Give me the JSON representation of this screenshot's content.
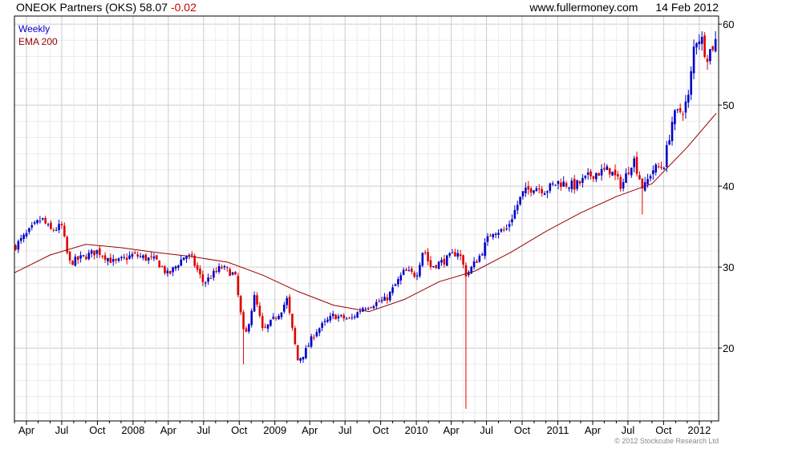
{
  "header": {
    "symbol_text": "ONEOK Partners (OKS) 58.07",
    "change": "-0.02",
    "website": "www.fullermoney.com",
    "date": "14 Feb 2012"
  },
  "footer": {
    "copyright": "© 2012 Stockcube Research Ltd"
  },
  "chart_data": {
    "type": "candlestick",
    "frequency": "Weekly",
    "grid": true,
    "legend_position": "top-left",
    "ylim": [
      11,
      61
    ],
    "y_ticks": [
      20,
      30,
      40,
      50,
      60
    ],
    "x_range": [
      "2007-03-01",
      "2012-02-20"
    ],
    "x_ticks": [
      {
        "date": "2007-04-01",
        "label": "Apr"
      },
      {
        "date": "2007-07-01",
        "label": "Jul"
      },
      {
        "date": "2007-10-01",
        "label": "Oct"
      },
      {
        "date": "2008-01-01",
        "label": "2008"
      },
      {
        "date": "2008-04-01",
        "label": "Apr"
      },
      {
        "date": "2008-07-01",
        "label": "Jul"
      },
      {
        "date": "2008-10-01",
        "label": "Oct"
      },
      {
        "date": "2009-01-01",
        "label": "2009"
      },
      {
        "date": "2009-04-01",
        "label": "Apr"
      },
      {
        "date": "2009-07-01",
        "label": "Jul"
      },
      {
        "date": "2009-10-01",
        "label": "Oct"
      },
      {
        "date": "2010-01-01",
        "label": "2010"
      },
      {
        "date": "2010-04-01",
        "label": "Apr"
      },
      {
        "date": "2010-07-01",
        "label": "Jul"
      },
      {
        "date": "2010-10-01",
        "label": "Oct"
      },
      {
        "date": "2011-01-01",
        "label": "2011"
      },
      {
        "date": "2011-04-01",
        "label": "Apr"
      },
      {
        "date": "2011-07-01",
        "label": "Jul"
      },
      {
        "date": "2011-10-01",
        "label": "Oct"
      },
      {
        "date": "2012-01-01",
        "label": "2012"
      }
    ],
    "series": [
      {
        "name": "Weekly",
        "color_up": "#0000cc",
        "color_down": "#dd0000",
        "anchors": [
          [
            "2007-03-01",
            32.5
          ],
          [
            "2007-04-01",
            34.0
          ],
          [
            "2007-05-10",
            36.0
          ],
          [
            "2007-06-01",
            34.5
          ],
          [
            "2007-07-01",
            35.0
          ],
          [
            "2007-07-20",
            30.5
          ],
          [
            "2007-08-15",
            31.0
          ],
          [
            "2007-10-01",
            32.0
          ],
          [
            "2007-11-15",
            30.5
          ],
          [
            "2008-01-01",
            31.5
          ],
          [
            "2008-03-01",
            30.8
          ],
          [
            "2008-04-01",
            29.0
          ],
          [
            "2008-05-15",
            31.5
          ],
          [
            "2008-06-01",
            31.0
          ],
          [
            "2008-07-01",
            28.0
          ],
          [
            "2008-08-15",
            30.0
          ],
          [
            "2008-09-20",
            29.0
          ],
          [
            "2008-10-15",
            21.0
          ],
          [
            "2008-11-10",
            26.5
          ],
          [
            "2008-12-01",
            22.0
          ],
          [
            "2009-01-15",
            24.5
          ],
          [
            "2009-02-01",
            26.0
          ],
          [
            "2009-03-01",
            18.5
          ],
          [
            "2009-03-20",
            19.5
          ],
          [
            "2009-04-15",
            22.0
          ],
          [
            "2009-06-01",
            24.0
          ],
          [
            "2009-07-15",
            23.5
          ],
          [
            "2009-08-15",
            25.0
          ],
          [
            "2009-10-15",
            26.0
          ],
          [
            "2009-12-01",
            29.5
          ],
          [
            "2010-01-01",
            29.0
          ],
          [
            "2010-01-20",
            32.5
          ],
          [
            "2010-02-05",
            30.0
          ],
          [
            "2010-03-15",
            30.8
          ],
          [
            "2010-04-20",
            32.0
          ],
          [
            "2010-05-10",
            29.0
          ],
          [
            "2010-06-15",
            31.5
          ],
          [
            "2010-07-15",
            34.5
          ],
          [
            "2010-08-20",
            34.5
          ],
          [
            "2010-10-01",
            39.0
          ],
          [
            "2010-11-01",
            40.0
          ],
          [
            "2010-12-01",
            39.5
          ],
          [
            "2011-01-01",
            40.5
          ],
          [
            "2011-02-15",
            40.0
          ],
          [
            "2011-04-01",
            41.5
          ],
          [
            "2011-05-15",
            42.0
          ],
          [
            "2011-06-15",
            40.0
          ],
          [
            "2011-07-15",
            43.5
          ],
          [
            "2011-08-10",
            39.5
          ],
          [
            "2011-09-01",
            42.0
          ],
          [
            "2011-10-01",
            42.5
          ],
          [
            "2011-10-25",
            48.5
          ],
          [
            "2011-11-20",
            49.5
          ],
          [
            "2011-12-05",
            51.0
          ],
          [
            "2011-12-20",
            58.0
          ],
          [
            "2012-01-05",
            58.5
          ],
          [
            "2012-01-20",
            56.0
          ],
          [
            "2012-02-14",
            58.07
          ]
        ],
        "spikes": [
          {
            "date": "2010-05-06",
            "low": 12.5
          },
          {
            "date": "2011-08-08",
            "low": 36.5
          },
          {
            "date": "2008-10-10",
            "low": 18.0
          }
        ]
      },
      {
        "name": "EMA 200",
        "color": "#990000",
        "values": [
          [
            "2007-03-01",
            29.3
          ],
          [
            "2007-06-01",
            31.5
          ],
          [
            "2007-09-01",
            32.8
          ],
          [
            "2007-12-01",
            32.4
          ],
          [
            "2008-03-01",
            31.8
          ],
          [
            "2008-06-01",
            31.3
          ],
          [
            "2008-09-01",
            30.6
          ],
          [
            "2008-12-01",
            29.0
          ],
          [
            "2009-03-01",
            27.0
          ],
          [
            "2009-06-01",
            25.3
          ],
          [
            "2009-09-01",
            24.5
          ],
          [
            "2009-12-01",
            26.0
          ],
          [
            "2010-03-01",
            28.2
          ],
          [
            "2010-06-01",
            29.5
          ],
          [
            "2010-09-01",
            31.8
          ],
          [
            "2010-12-01",
            34.4
          ],
          [
            "2011-03-01",
            36.7
          ],
          [
            "2011-06-01",
            38.7
          ],
          [
            "2011-09-01",
            40.3
          ],
          [
            "2011-12-01",
            44.8
          ],
          [
            "2012-02-14",
            49.0
          ]
        ]
      }
    ]
  }
}
